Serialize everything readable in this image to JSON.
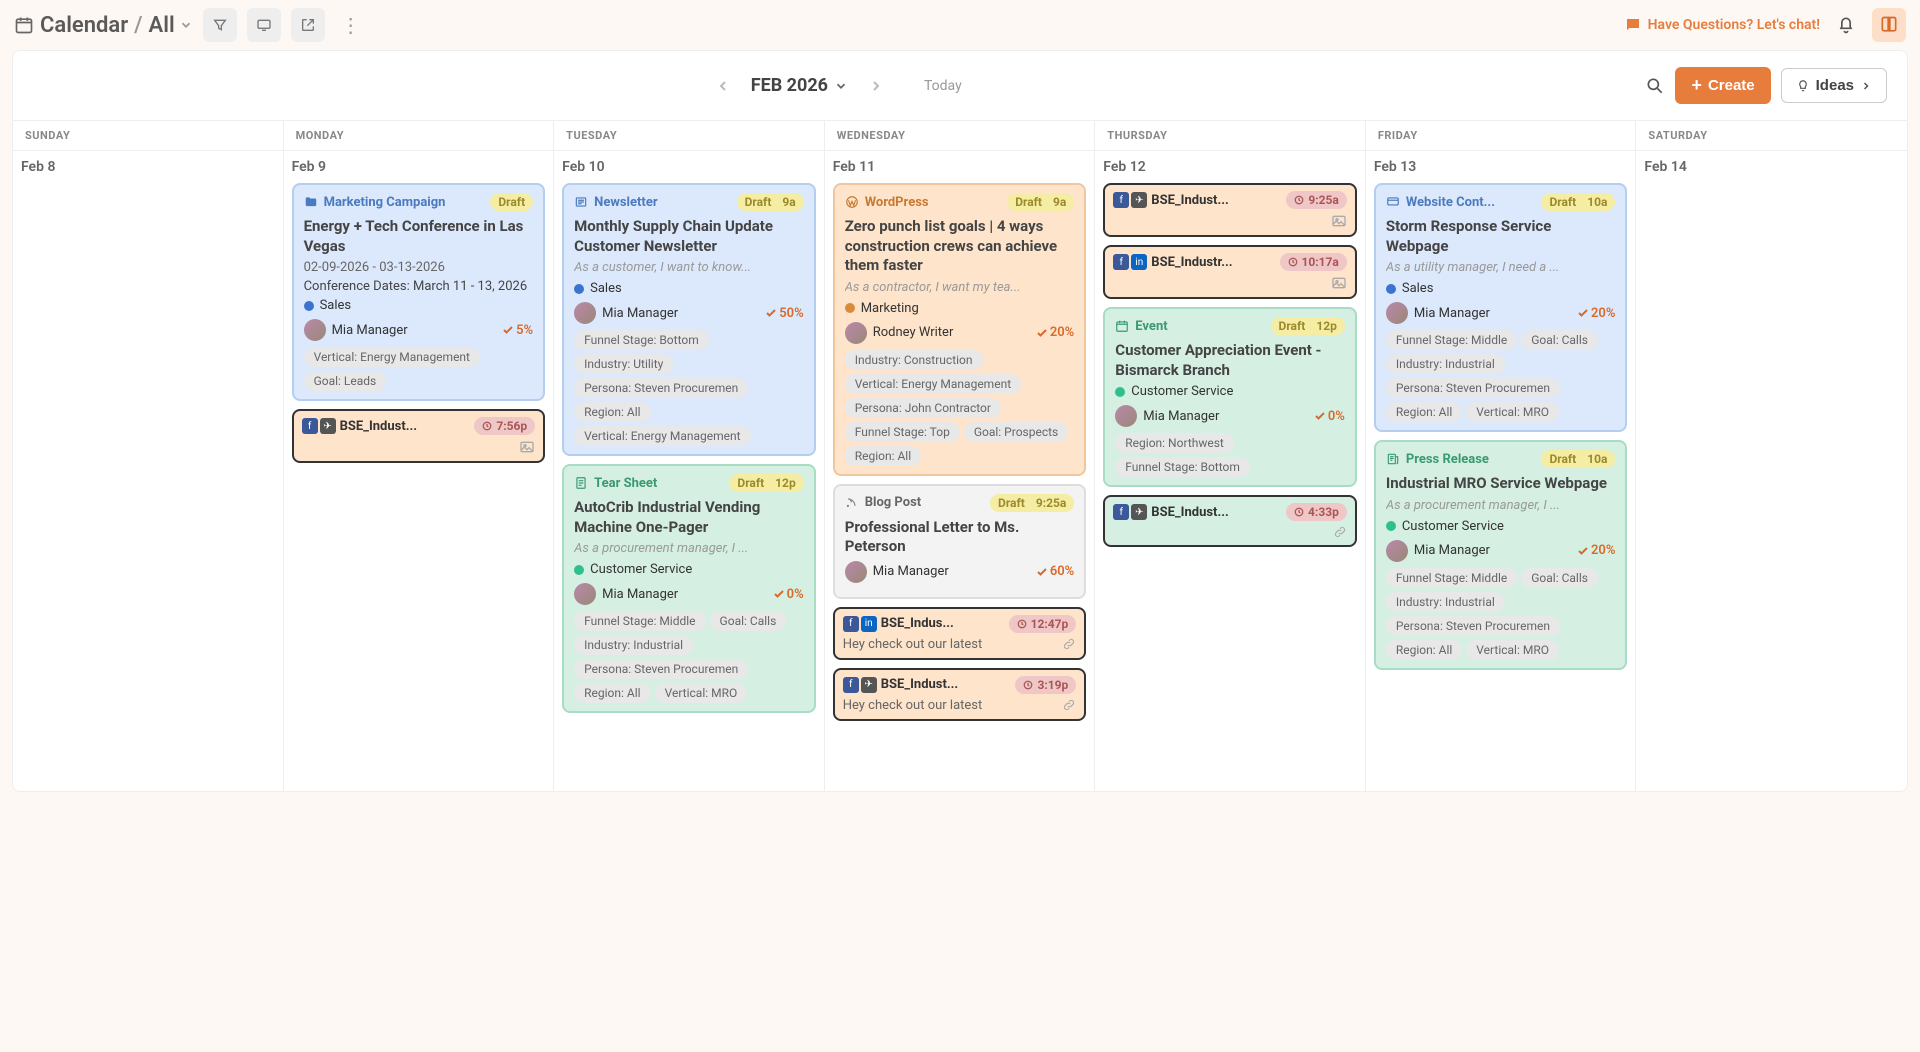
{
  "breadcrumb": {
    "root": "Calendar",
    "view": "All"
  },
  "chat_text": "Have Questions? Let's chat!",
  "month_label": "FEB 2026",
  "today_label": "Today",
  "create_label": "Create",
  "ideas_label": "Ideas",
  "day_headers": [
    "SUNDAY",
    "MONDAY",
    "TUESDAY",
    "WEDNESDAY",
    "THURSDAY",
    "FRIDAY",
    "SATURDAY"
  ],
  "dates": [
    "Feb 8",
    "Feb 9",
    "Feb 10",
    "Feb 11",
    "Feb 12",
    "Feb 13",
    "Feb 14"
  ],
  "labels": {
    "draft": "Draft"
  },
  "cards": {
    "mon1": {
      "type": "Marketing Campaign",
      "status": "Draft",
      "title": "Energy + Tech Conference in Las Vegas",
      "date_range": "02-09-2026 - 03-13-2026",
      "sub": "Conference Dates: March 11 - 13, 2026",
      "category": "Sales",
      "assignee": "Mia Manager",
      "pct": "5%",
      "tags": [
        "Vertical: Energy Management",
        "Goal: Leads"
      ]
    },
    "mon2": {
      "name": "BSE_Indust...",
      "time": "7:56p"
    },
    "tue1": {
      "type": "Newsletter",
      "status": "Draft",
      "time": "9a",
      "title": "Monthly Supply Chain Update Customer Newsletter",
      "desc": "As a customer, I want to know...",
      "category": "Sales",
      "assignee": "Mia Manager",
      "pct": "50%",
      "tags": [
        "Funnel Stage: Bottom",
        "Industry: Utility",
        "Persona: Steven Procuremen",
        "Region: All",
        "Vertical: Energy Management"
      ]
    },
    "tue2": {
      "type": "Tear Sheet",
      "status": "Draft",
      "time": "12p",
      "title": "AutoCrib Industrial Vending Machine One-Pager",
      "desc": "As a procurement manager, I ...",
      "category": "Customer Service",
      "assignee": "Mia Manager",
      "pct": "0%",
      "tags": [
        "Funnel Stage: Middle",
        "Goal: Calls",
        "Industry: Industrial",
        "Persona: Steven Procuremen",
        "Region: All",
        "Vertical: MRO"
      ]
    },
    "wed1": {
      "type": "WordPress",
      "status": "Draft",
      "time": "9a",
      "title": "Zero punch list goals | 4 ways construction crews can achieve them faster",
      "desc": "As a contractor, I want my tea...",
      "category": "Marketing",
      "assignee": "Rodney Writer",
      "pct": "20%",
      "tags": [
        "Industry: Construction",
        "Vertical: Energy Management",
        "Persona: John Contractor",
        "Funnel Stage: Top",
        "Goal: Prospects",
        "Region: All"
      ]
    },
    "wed2": {
      "type": "Blog Post",
      "status": "Draft",
      "time": "9:25a",
      "title": "Professional Letter to Ms. Peterson",
      "assignee": "Mia Manager",
      "pct": "60%"
    },
    "wed3": {
      "name": "BSE_Indus...",
      "time": "12:47p",
      "text": "Hey check out our latest"
    },
    "wed4": {
      "name": "BSE_Indust...",
      "time": "3:19p",
      "text": "Hey check out our latest"
    },
    "thu1": {
      "name": "BSE_Indust...",
      "time": "9:25a"
    },
    "thu2": {
      "name": "BSE_Industr...",
      "time": "10:17a"
    },
    "thu3": {
      "type": "Event",
      "status": "Draft",
      "time": "12p",
      "title": "Customer Appreciation Event - Bismarck Branch",
      "category": "Customer Service",
      "assignee": "Mia Manager",
      "pct": "0%",
      "tags": [
        "Region: Northwest",
        "Funnel Stage: Bottom"
      ]
    },
    "thu4": {
      "name": "BSE_Indust...",
      "time": "4:33p"
    },
    "fri1": {
      "type": "Website Cont...",
      "status": "Draft",
      "time": "10a",
      "title": "Storm Response Service Webpage",
      "desc": "As a utility manager, I need a ...",
      "category": "Sales",
      "assignee": "Mia Manager",
      "pct": "20%",
      "tags": [
        "Funnel Stage: Middle",
        "Goal: Calls",
        "Industry: Industrial",
        "Persona: Steven Procuremen",
        "Region: All",
        "Vertical: MRO"
      ]
    },
    "fri2": {
      "type": "Press Release",
      "status": "Draft",
      "time": "10a",
      "title": "Industrial MRO Service Webpage",
      "desc": "As a procurement manager, I ...",
      "category": "Customer Service",
      "assignee": "Mia Manager",
      "pct": "20%",
      "tags": [
        "Funnel Stage: Middle",
        "Goal: Calls",
        "Industry: Industrial",
        "Persona: Steven Procuremen",
        "Region: All",
        "Vertical: MRO"
      ]
    }
  },
  "colors": {
    "sales": "#3b73d1",
    "marketing": "#d88b3b",
    "customer_service": "#2fbf8f"
  }
}
